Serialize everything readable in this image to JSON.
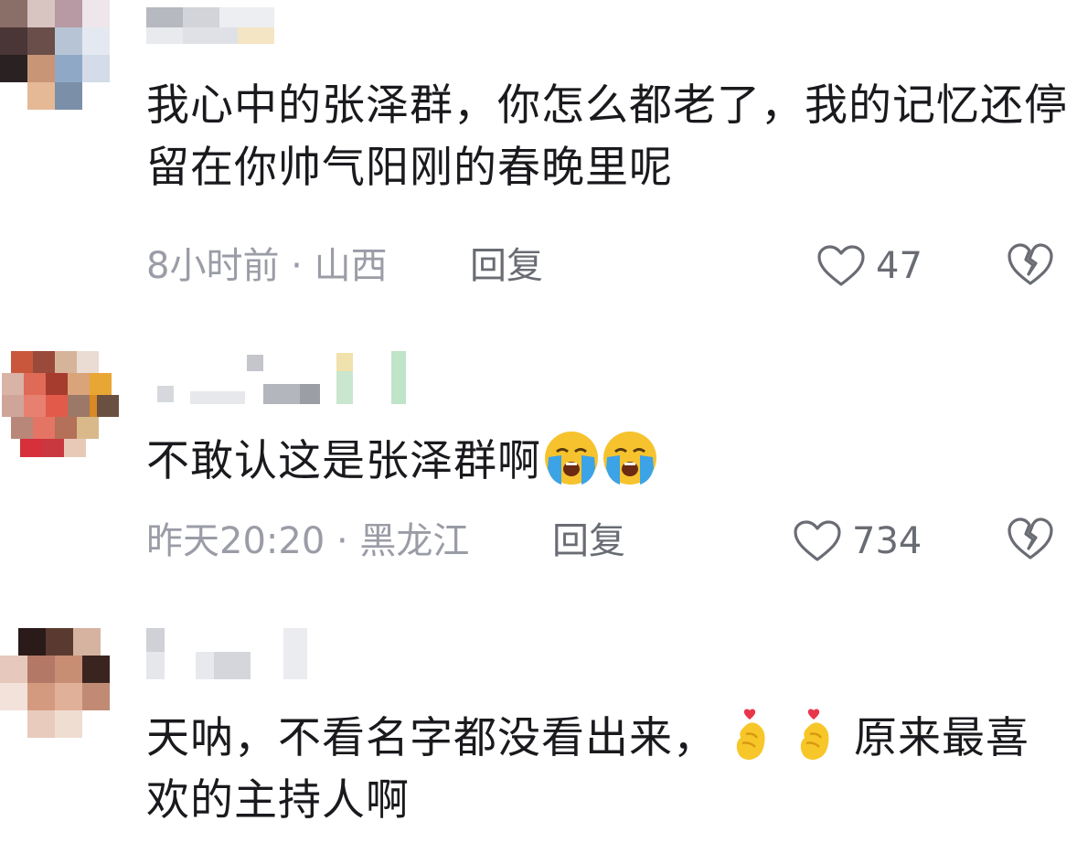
{
  "comments": [
    {
      "text": "我心中的张泽群，你怎么都老了，我的记忆还停留在你帅气阳刚的春晚里呢",
      "time_location": "8小时前 · 山西",
      "reply_label": "回复",
      "likes": "47",
      "emoji": []
    },
    {
      "text": "不敢认这是张泽群啊",
      "time_location": "昨天20:20 · 黑龙江",
      "reply_label": "回复",
      "likes": "734",
      "emoji": [
        "loudly-crying-face",
        "loudly-crying-face"
      ]
    },
    {
      "text_part1": "天呐，不看名字都没看出来，",
      "text_part2": "原来最喜欢的主持人啊",
      "emoji": [
        "heart-hands",
        "heart-hands"
      ]
    }
  ],
  "colors": {
    "meta_gray": "#9a9ca6",
    "action_gray": "#6a6c74",
    "text": "#1a1a1e",
    "emoji_yellow": "#f6c32e",
    "emoji_tear": "#3ca3e6",
    "heart_red": "#e8364b"
  },
  "icons": [
    "like-heart-icon",
    "dislike-broken-heart-icon"
  ]
}
